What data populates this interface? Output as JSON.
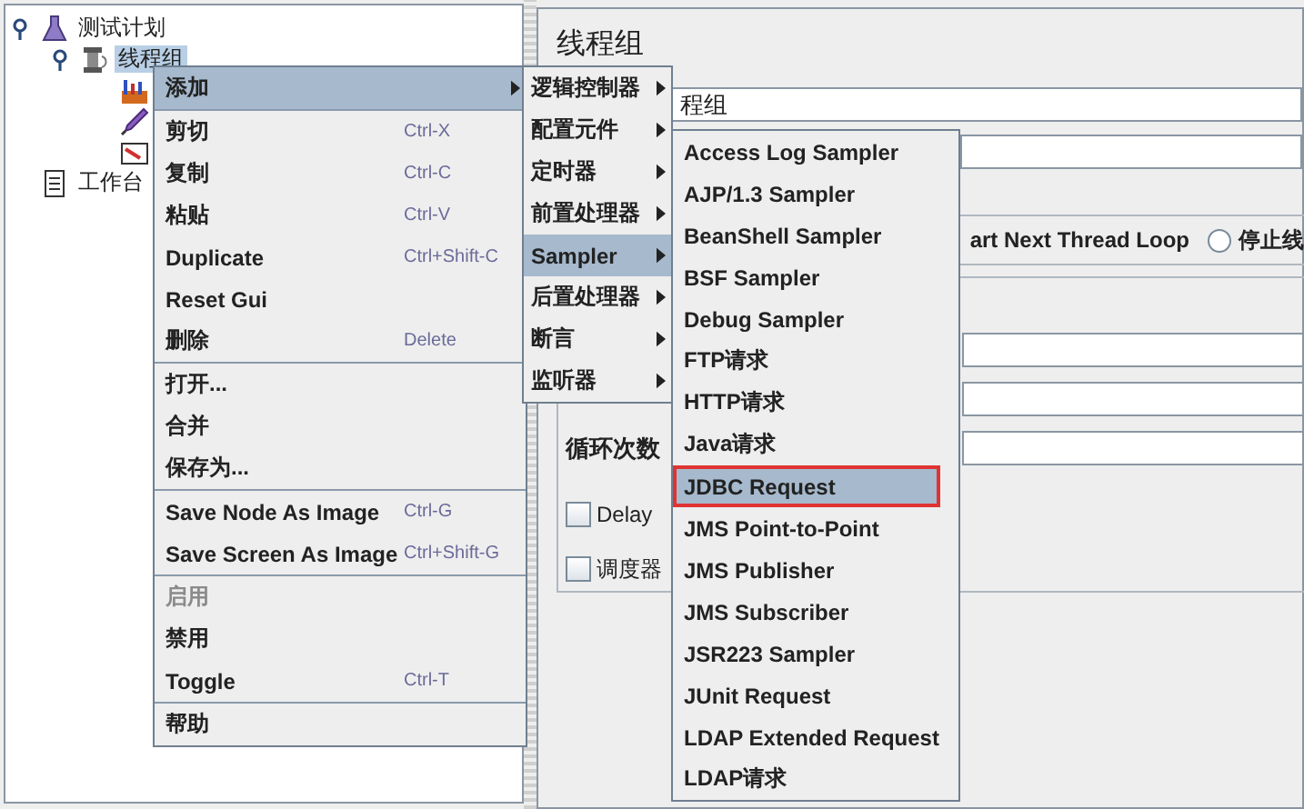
{
  "tree": [
    {
      "label": "测试计划",
      "kind": "plan",
      "expanded": true,
      "selected": false,
      "children": [
        {
          "label": "线程组",
          "kind": "thread_group",
          "expanded": true,
          "selected": true,
          "children": [
            {
              "kind": "chart"
            },
            {
              "kind": "pipette"
            },
            {
              "kind": "image"
            }
          ]
        }
      ]
    },
    {
      "label": "工作台",
      "kind": "workbench",
      "selected": false
    }
  ],
  "panel": {
    "title": "线程组",
    "name_field": {
      "value": "程组"
    },
    "error_actions": [
      {
        "label": "art Next Thread Loop"
      },
      {
        "label": "停止线",
        "selected": false
      }
    ],
    "field_rows": [
      {
        "label": "循环次数"
      }
    ],
    "checkboxes": [
      {
        "label": "Delay",
        "checked": false
      },
      {
        "label": "调度器",
        "checked": false
      }
    ]
  },
  "context_menu": {
    "groups": [
      [
        {
          "label": "添加",
          "submenu": true,
          "selected": true,
          "disabled": false
        }
      ],
      [
        {
          "label": "剪切",
          "shortcut": "Ctrl-X",
          "submenu": false,
          "selected": false,
          "disabled": false
        },
        {
          "label": "复制",
          "shortcut": "Ctrl-C",
          "submenu": false,
          "selected": false,
          "disabled": false
        },
        {
          "label": "粘贴",
          "shortcut": "Ctrl-V",
          "submenu": false,
          "selected": false,
          "disabled": false
        },
        {
          "label": "Duplicate",
          "shortcut": "Ctrl+Shift-C",
          "submenu": false,
          "selected": false,
          "disabled": false
        },
        {
          "label": "Reset Gui",
          "submenu": false,
          "selected": false,
          "disabled": false
        },
        {
          "label": "删除",
          "shortcut": "Delete",
          "submenu": false,
          "selected": false,
          "disabled": false
        }
      ],
      [
        {
          "label": "打开...",
          "submenu": false,
          "selected": false,
          "disabled": false
        },
        {
          "label": "合并",
          "submenu": false,
          "selected": false,
          "disabled": false
        },
        {
          "label": "保存为...",
          "submenu": false,
          "selected": false,
          "disabled": false
        }
      ],
      [
        {
          "label": "Save Node As Image",
          "shortcut": "Ctrl-G",
          "submenu": false,
          "selected": false,
          "disabled": false
        },
        {
          "label": "Save Screen As Image",
          "shortcut": "Ctrl+Shift-G",
          "submenu": false,
          "selected": false,
          "disabled": false
        }
      ],
      [
        {
          "label": "启用",
          "submenu": false,
          "selected": false,
          "disabled": true
        },
        {
          "label": "禁用",
          "submenu": false,
          "selected": false,
          "disabled": false
        },
        {
          "label": "Toggle",
          "shortcut": "Ctrl-T",
          "submenu": false,
          "selected": false,
          "disabled": false
        }
      ],
      [
        {
          "label": "帮助",
          "submenu": false,
          "selected": false,
          "disabled": false
        }
      ]
    ]
  },
  "add_menu": {
    "items": [
      {
        "label": "逻辑控制器",
        "selected": false
      },
      {
        "label": "配置元件",
        "selected": false
      },
      {
        "label": "定时器",
        "selected": false
      },
      {
        "label": "前置处理器",
        "selected": false
      },
      {
        "label": "Sampler",
        "selected": true
      },
      {
        "label": "后置处理器",
        "selected": false
      },
      {
        "label": "断言",
        "selected": false
      },
      {
        "label": "监听器",
        "selected": false
      }
    ]
  },
  "sampler_menu": {
    "items": [
      {
        "label": "Access Log Sampler",
        "selected": false,
        "outlined": false
      },
      {
        "label": "AJP/1.3 Sampler",
        "selected": false,
        "outlined": false
      },
      {
        "label": "BeanShell Sampler",
        "selected": false,
        "outlined": false
      },
      {
        "label": "BSF Sampler",
        "selected": false,
        "outlined": false
      },
      {
        "label": "Debug Sampler",
        "selected": false,
        "outlined": false
      },
      {
        "label": "FTP请求",
        "selected": false,
        "outlined": false
      },
      {
        "label": "HTTP请求",
        "selected": false,
        "outlined": false
      },
      {
        "label": "Java请求",
        "selected": false,
        "outlined": false
      },
      {
        "label": "JDBC Request",
        "selected": true,
        "outlined": true
      },
      {
        "label": "JMS Point-to-Point",
        "selected": false,
        "outlined": false
      },
      {
        "label": "JMS Publisher",
        "selected": false,
        "outlined": false
      },
      {
        "label": "JMS Subscriber",
        "selected": false,
        "outlined": false
      },
      {
        "label": "JSR223 Sampler",
        "selected": false,
        "outlined": false
      },
      {
        "label": "JUnit Request",
        "selected": false,
        "outlined": false
      },
      {
        "label": "LDAP Extended Request",
        "selected": false,
        "outlined": false
      },
      {
        "label": "LDAP请求",
        "selected": false,
        "outlined": false
      }
    ]
  }
}
